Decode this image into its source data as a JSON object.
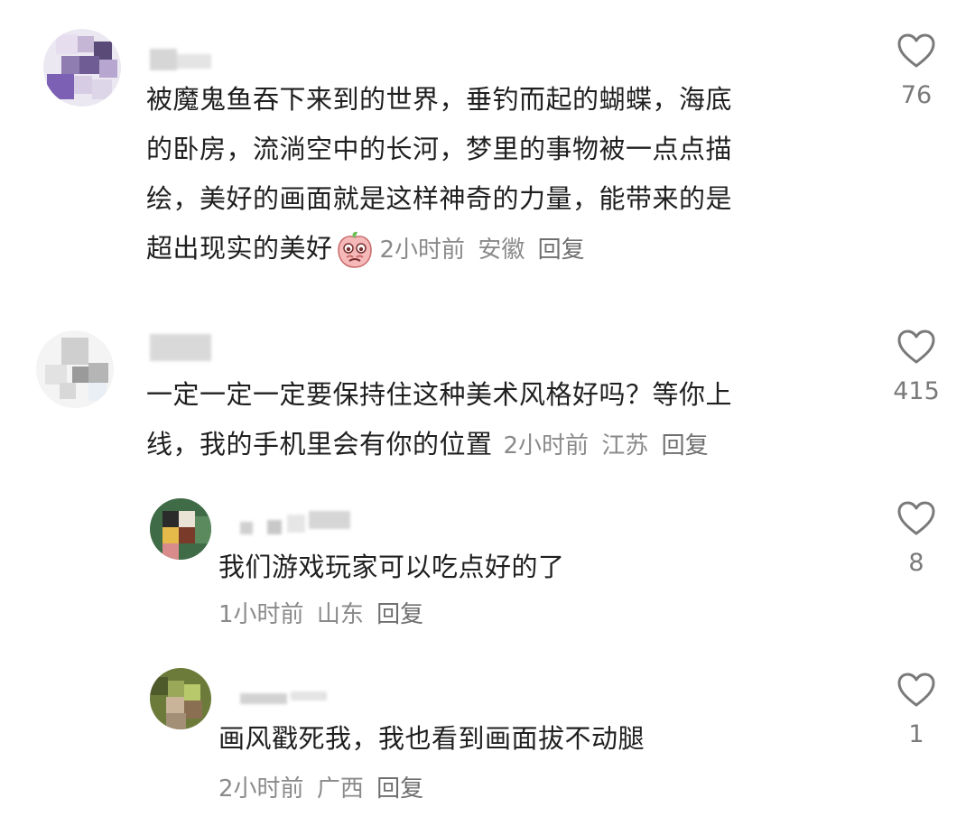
{
  "comments": [
    {
      "text": "被魔鬼鱼吞下来到的世界，垂钓而起的蝴蝶，海底的卧房，流淌空中的长河，梦里的事物被一点点描绘，美好的画面就是这样神奇的力量，能带来的是超出现实的美好",
      "lines": [
        "被魔鬼鱼吞下来到的世界，垂钓而起的蝴蝶，海底",
        "的卧房，流淌空中的长河，梦里的事物被一点点描",
        "绘，美好的画面就是这样神奇的力量，能带来的是",
        "超出现实的美好"
      ],
      "time": "2小时前",
      "location": "安徽",
      "reply": "回复",
      "likes": "76"
    },
    {
      "lines": [
        "一定一定一定要保持住这种美术风格好吗？等你上",
        "线，我的手机里会有你的位置"
      ],
      "time": "2小时前",
      "location": "江苏",
      "reply": "回复",
      "likes": "415"
    },
    {
      "lines": [
        "我们游戏玩家可以吃点好的了"
      ],
      "time": "1小时前",
      "location": "山东",
      "reply": "回复",
      "likes": "8"
    },
    {
      "lines": [
        "画风戳死我，我也看到画面拔不动腿"
      ],
      "time": "2小时前",
      "location": "广西",
      "reply": "回复",
      "likes": "1"
    }
  ],
  "colors": {
    "text": "#1f1f1f",
    "meta": "#8a8a8a",
    "heart": "#7a7a7a"
  },
  "icons": {
    "like": "heart-outline-icon",
    "sticker": "crying-peach-emoji"
  }
}
